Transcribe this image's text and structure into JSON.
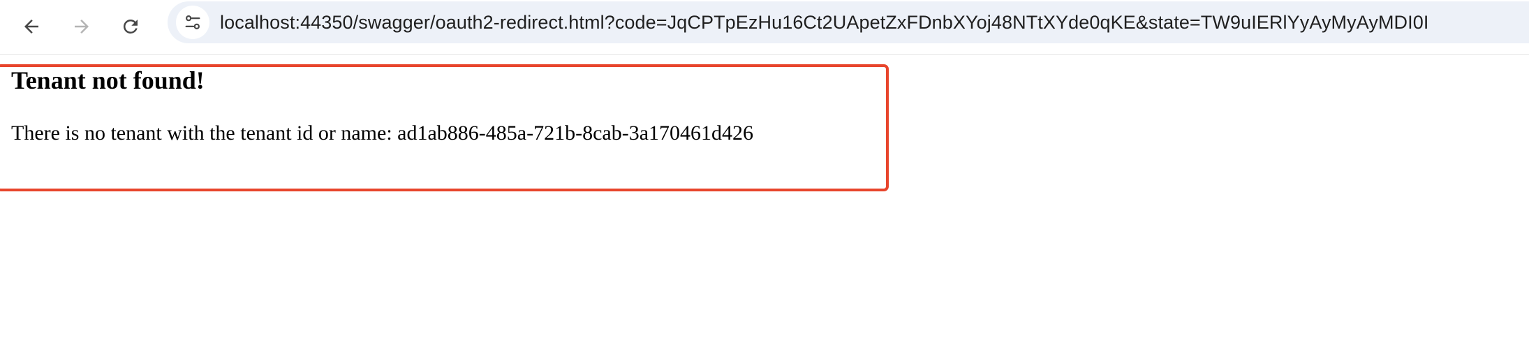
{
  "browser": {
    "url": "localhost:44350/swagger/oauth2-redirect.html?code=JqCPTpEzHu16Ct2UApetZxFDnbXYoj48NTtXYde0qKE&state=TW9uIERlYyAyMyAyMDI0I",
    "back_icon": "arrow-left-icon",
    "forward_icon": "arrow-right-icon",
    "reload_icon": "reload-icon",
    "site_info_icon": "tune-icon"
  },
  "page": {
    "title": "Tenant not found!",
    "message": "There is no tenant with the tenant id or name: ad1ab886-485a-721b-8cab-3a170461d426"
  },
  "colors": {
    "error_border": "#e8452c",
    "omnibox_bg": "#edf1f8"
  }
}
